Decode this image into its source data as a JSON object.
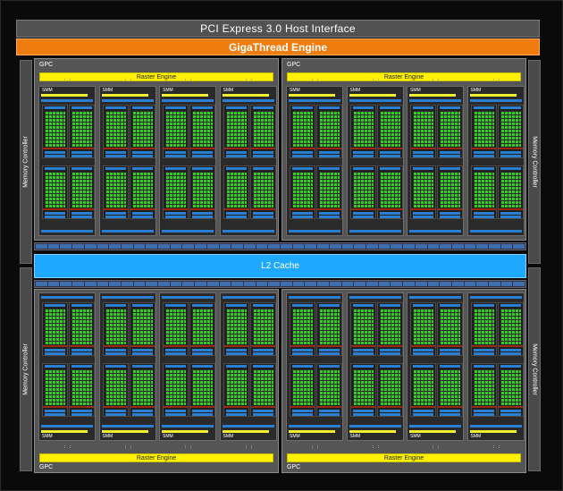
{
  "header": {
    "pcie_label": "PCI Express 3.0 Host Interface",
    "gigathread_label": "GigaThread Engine"
  },
  "memory_controller_label": "Memory Controller",
  "l2_label": "L2 Cache",
  "gpc_label": "GPC",
  "raster_label": "Raster Engine",
  "smm_label": "SMM",
  "colors": {
    "pcie": "#525252",
    "gigathread": "#f07c10",
    "l2": "#1fa8ff",
    "raster": "#fff000",
    "cores": "#32d01e",
    "memory_controller": "#4a4a4a"
  }
}
